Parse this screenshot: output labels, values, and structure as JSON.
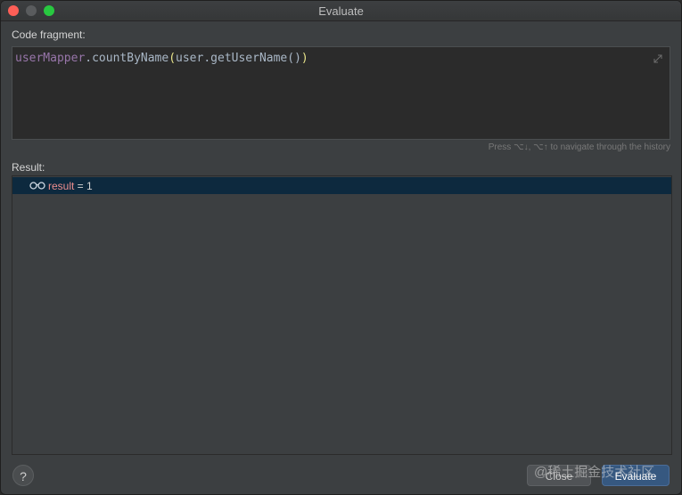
{
  "window": {
    "title": "Evaluate"
  },
  "editor": {
    "label": "Code fragment:",
    "code_var": "userMapper",
    "code_method": ".countByName",
    "code_open": "(",
    "code_arg": "user.getUserName()",
    "code_close": ")"
  },
  "history_hint": "Press ⌥↓, ⌥↑ to navigate through the history",
  "result": {
    "label": "Result:",
    "name": "result",
    "equals": " = ",
    "value": "1"
  },
  "buttons": {
    "help": "?",
    "close": "Close",
    "evaluate": "Evaluate"
  },
  "watermark": "@稀土掘金技术社区",
  "colors": {
    "window_bg": "#3c3f41",
    "editor_bg": "#2b2b2b",
    "selection": "#0d293e",
    "accent": "#365880"
  }
}
